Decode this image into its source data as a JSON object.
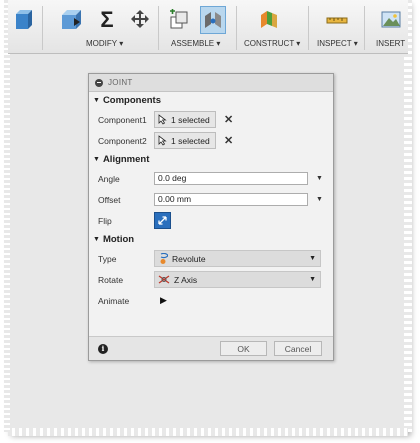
{
  "ribbon": {
    "groups": {
      "modify": "MODIFY ▾",
      "assemble": "ASSEMBLE ▾",
      "construct": "CONSTRUCT ▾",
      "inspect": "INSPECT ▾",
      "insert": "INSERT"
    },
    "tools": [
      "press-pull-icon",
      "fillet-icon",
      "sum-icon",
      "move-icon",
      "new-component-icon",
      "joint-icon",
      "construct-plane-icon",
      "measure-icon",
      "insert-image-icon"
    ],
    "sum_glyph": "Σ"
  },
  "dialog": {
    "title": "JOINT",
    "components": {
      "heading": "Components",
      "component1_label": "Component1",
      "component1_value": "1 selected",
      "component2_label": "Component2",
      "component2_value": "1 selected"
    },
    "alignment": {
      "heading": "Alignment",
      "angle_label": "Angle",
      "angle_value": "0.0 deg",
      "offset_label": "Offset",
      "offset_value": "0.00 mm",
      "flip_label": "Flip"
    },
    "motion": {
      "heading": "Motion",
      "type_label": "Type",
      "type_value": "Revolute",
      "rotate_label": "Rotate",
      "rotate_value": "Z Axis",
      "animate_label": "Animate"
    },
    "footer": {
      "ok_label": "OK",
      "cancel_label": "Cancel"
    }
  },
  "colors": {
    "accent": "#2a6fbd",
    "active_tool": "#b9d7ee",
    "background": "#e8e8e8"
  }
}
